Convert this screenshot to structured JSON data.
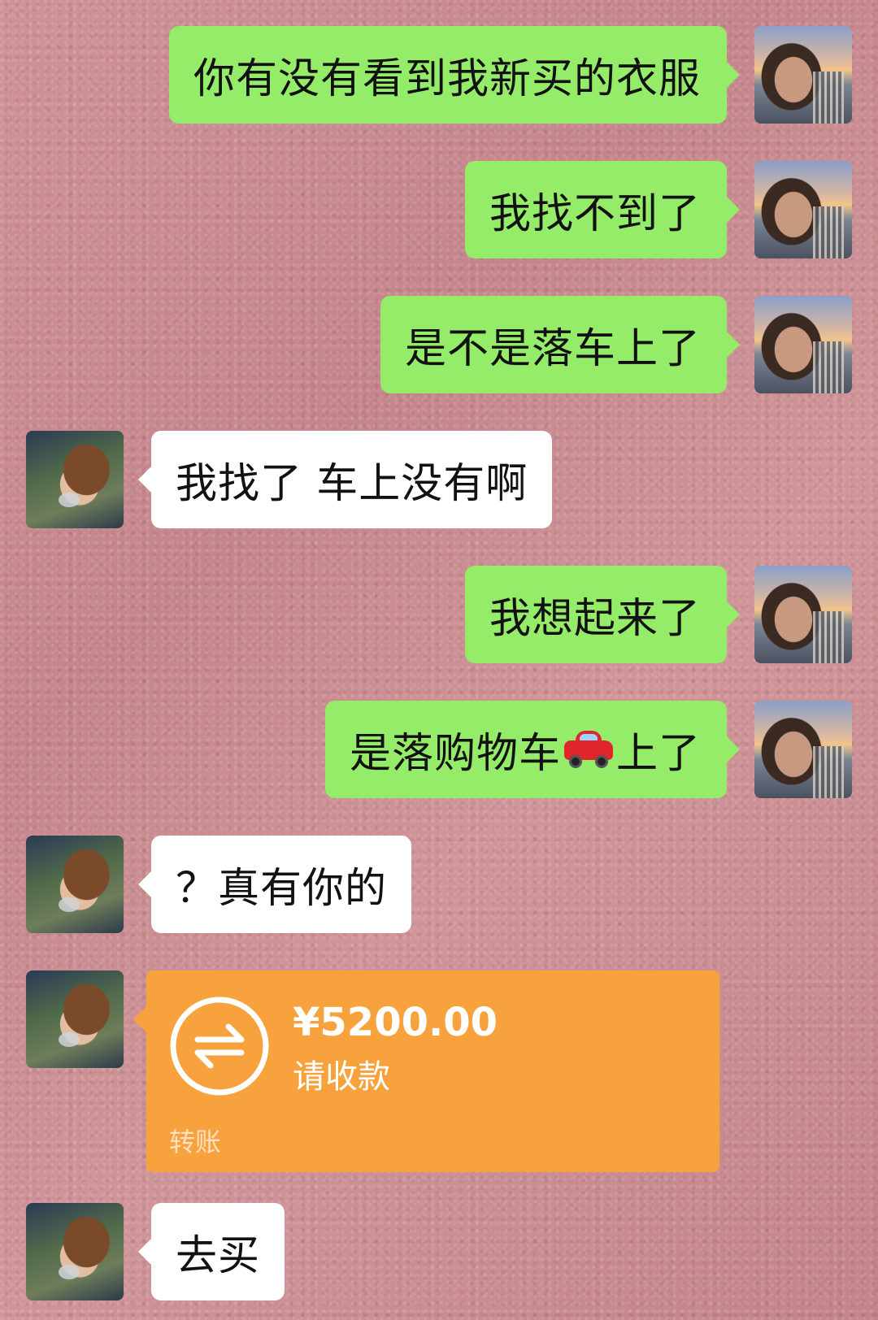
{
  "chat": {
    "messages": [
      {
        "sender": "me",
        "text": "你有没有看到我新买的衣服"
      },
      {
        "sender": "me",
        "text": "我找不到了"
      },
      {
        "sender": "me",
        "text": "是不是落车上了"
      },
      {
        "sender": "them",
        "text": "我找了 车上没有啊"
      },
      {
        "sender": "me",
        "text": "我想起来了"
      },
      {
        "sender": "me",
        "text_before": "是落购物车",
        "emoji": "car-emoji",
        "text_after": "上了"
      },
      {
        "sender": "them",
        "text": "？真有你的"
      },
      {
        "sender": "them",
        "type": "transfer",
        "amount": "¥5200.00",
        "note": "请收款",
        "label": "转账",
        "icon": "transfer-arrows-icon",
        "color": "#f7a23c"
      },
      {
        "sender": "them",
        "text": "去买"
      }
    ]
  },
  "colors": {
    "my_bubble": "#95ec69",
    "their_bubble": "#ffffff",
    "transfer_card": "#f7a23c",
    "background": "#c98a8e"
  }
}
